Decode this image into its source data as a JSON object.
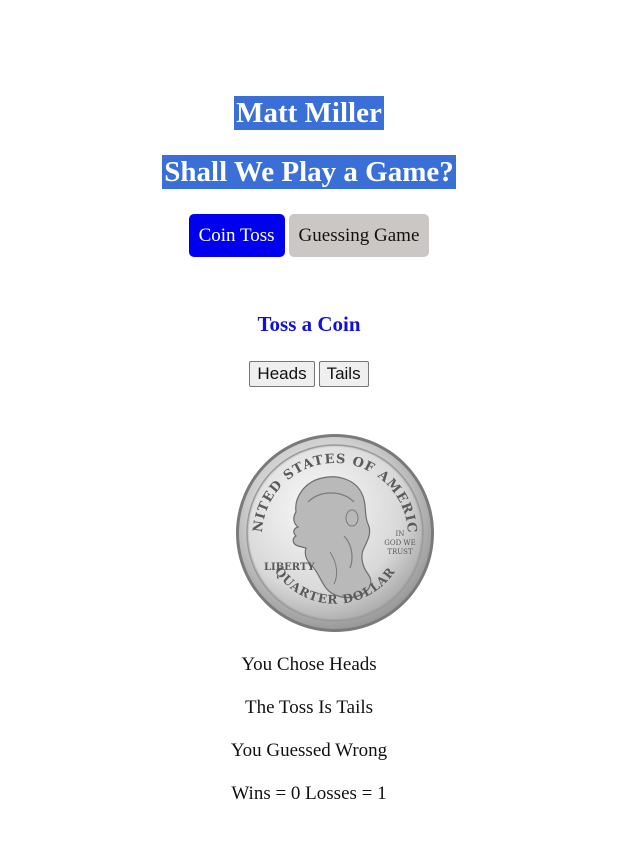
{
  "header": {
    "name": "Matt Miller",
    "game_title": "Shall We Play a Game?"
  },
  "tabs": [
    {
      "label": "Coin Toss",
      "active": true
    },
    {
      "label": "Guessing Game",
      "active": false
    }
  ],
  "coin_toss": {
    "heading": "Toss a Coin",
    "buttons": {
      "heads": "Heads",
      "tails": "Tails"
    },
    "coin_image": {
      "icon": "quarter-coin-icon",
      "text_top": "UNITED STATES OF AMERICA",
      "text_bottom": "QUARTER DOLLAR",
      "text_left": "LIBERTY",
      "motto": [
        "IN",
        "GOD WE",
        "TRUST"
      ]
    },
    "results": {
      "chose": "You Chose Heads",
      "toss": "The Toss Is Tails",
      "guess": "You Guessed Wrong",
      "score": "Wins = 0 Losses = 1"
    }
  },
  "colors": {
    "title_highlight": "#3a6fd8",
    "active_tab": "#0000ee",
    "inactive_tab": "#cbc7c5",
    "heading": "#1010d8"
  }
}
